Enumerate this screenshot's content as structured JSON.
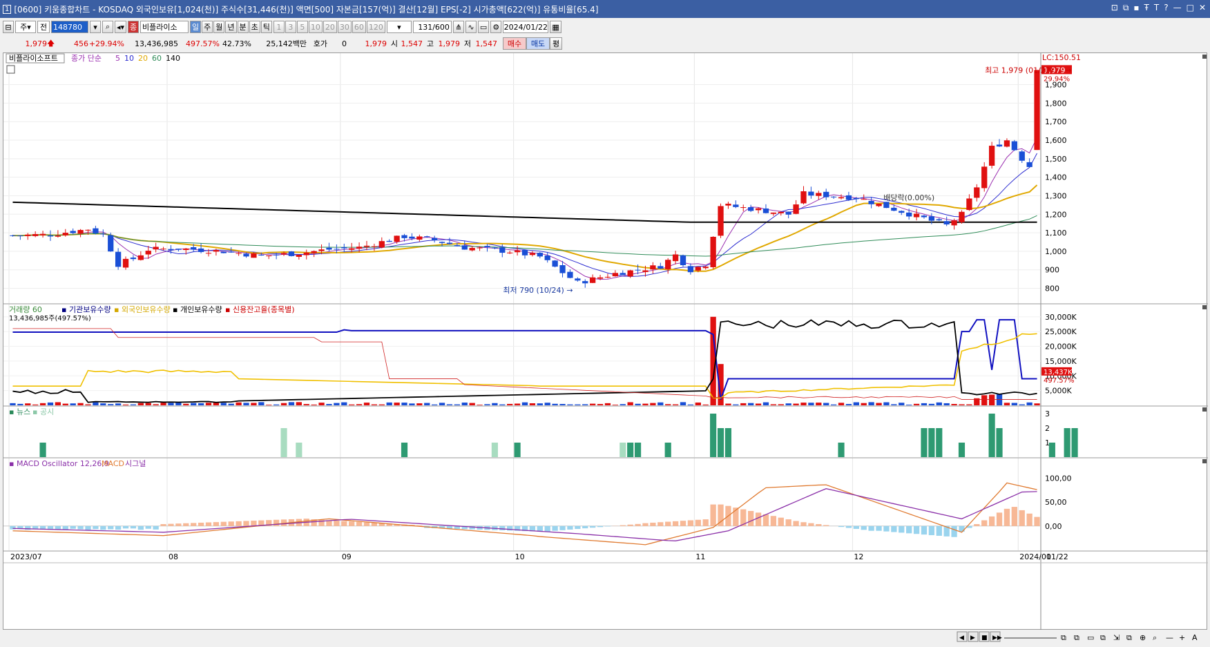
{
  "window": {
    "number": "1",
    "title": "[0600] 키움종합차트 - KOSDAQ 외국인보유[1,024(천)] 주식수[31,446(천)] 액면[500] 자본금[157(억)] 결산[12월] EPS[-2] 시가총액[622(억)] 유통비율[65.4]",
    "controls": [
      "⊡",
      "⧉",
      "▪",
      "Ŧ",
      "T",
      "?",
      "—",
      "□",
      "✕"
    ]
  },
  "toolbar": {
    "period_type": "주",
    "mode": "전",
    "code": "148780",
    "stock_name": "비플라이소",
    "periods": [
      "일",
      "주",
      "월",
      "년",
      "분",
      "초",
      "틱"
    ],
    "active_period": "일",
    "minutes": [
      "1",
      "3",
      "5",
      "10",
      "20",
      "30",
      "60",
      "120"
    ],
    "count": "131",
    "count_total": "/600",
    "date": "2024/01/22"
  },
  "quote": {
    "price": "1,979",
    "change": "456",
    "change_pct": "+29.94%",
    "volume": "13,436,985",
    "vol_ratio": "497.57%",
    "turnover": "42.73%",
    "amount": "25,142백만",
    "hoga_label": "호가",
    "hoga": "0",
    "p1": "1,979",
    "open_label": "시",
    "open": "1,547",
    "high_label": "고",
    "high": "1,979",
    "low_label": "저",
    "low": "1,547",
    "buy": "매수",
    "sell": "매도",
    "flat": "평"
  },
  "price_panel": {
    "stock_label": "비플라이소프트",
    "ma_label": "종가 단순",
    "ma": [
      "5",
      "10",
      "20",
      "60",
      "140"
    ],
    "ma_colors": [
      "#9b30b0",
      "#2b2bd0",
      "#e0a800",
      "#2e8b57",
      "#000000"
    ],
    "max_label": "최고 1,979 (01/22)",
    "min_label": "최저 790 (10/24)",
    "div_label": "배당락(0.00%)",
    "lc_label": "LC:150.51",
    "cur_label": "1,979",
    "pct_label": "29.94%",
    "y_ticks": [
      "1,900",
      "1,800",
      "1,700",
      "1,600",
      "1,500",
      "1,400",
      "1,300",
      "1,200",
      "1,100",
      "1,000",
      "900",
      "800"
    ]
  },
  "vol_panel": {
    "labels": [
      "거래량 60",
      "기관보유수량",
      "외국인보유수량",
      "개인보유수량",
      "신용잔고율(종목별)"
    ],
    "label_colors": [
      "#3a8a3a",
      "#000080",
      "#d4a800",
      "#000000",
      "#cc0000"
    ],
    "value_text": "13,436,985주(497.57%)",
    "y_ticks": [
      "30,000K",
      "25,000K",
      "20,000K",
      "15,000K",
      "10,000K",
      "5,000K"
    ],
    "cur_tag": "13,437K",
    "pct_tag": "497.57%"
  },
  "news_panel": {
    "labels": [
      "뉴스",
      "공시"
    ],
    "y_ticks": [
      "3",
      "2",
      "1"
    ]
  },
  "macd_panel": {
    "label": "MACD Oscillator 12,26,9",
    "label2": "MACD",
    "label3": "시그널",
    "y_ticks": [
      "100,00",
      "50,00",
      "0,00"
    ]
  },
  "x_axis": {
    "labels": [
      "2023/07",
      "08",
      "09",
      "10",
      "11",
      "12",
      "2024/01",
      "01/22"
    ]
  },
  "chart_data": {
    "type": "candlestick",
    "x": [
      "07-03",
      "07-04",
      "07-05",
      "07-06",
      "07-07",
      "07-10",
      "07-11",
      "07-12",
      "07-13",
      "07-14",
      "07-17",
      "07-18",
      "07-19",
      "07-20",
      "07-21",
      "07-24",
      "07-25",
      "07-26",
      "07-27",
      "07-28",
      "07-31",
      "08-01",
      "08-02",
      "08-03",
      "08-04",
      "08-07",
      "08-08",
      "08-09",
      "08-10",
      "08-11",
      "08-14",
      "08-16",
      "08-17",
      "08-18",
      "08-21",
      "08-22",
      "08-23",
      "08-24",
      "08-25",
      "08-28",
      "08-29",
      "08-30",
      "08-31",
      "09-01",
      "09-04",
      "09-05",
      "09-06",
      "09-07",
      "09-08",
      "09-11",
      "09-12",
      "09-13",
      "09-14",
      "09-15",
      "09-18",
      "09-19",
      "09-20",
      "09-21",
      "09-22",
      "09-25",
      "09-26",
      "09-27",
      "10-04",
      "10-05",
      "10-06",
      "10-10",
      "10-11",
      "10-12",
      "10-13",
      "10-16",
      "10-17",
      "10-18",
      "10-19",
      "10-20",
      "10-23",
      "10-24",
      "10-25",
      "10-26",
      "10-27",
      "10-30",
      "10-31",
      "11-01",
      "11-02",
      "11-03",
      "11-06",
      "11-07",
      "11-08",
      "11-09",
      "11-10",
      "11-13",
      "11-14",
      "11-15",
      "11-16",
      "11-17",
      "11-20",
      "11-21",
      "11-22",
      "11-23",
      "11-24",
      "11-27",
      "11-28",
      "11-29",
      "11-30",
      "12-01",
      "12-04",
      "12-05",
      "12-06",
      "12-07",
      "12-08",
      "12-11",
      "12-12",
      "12-13",
      "12-14",
      "12-15",
      "12-18",
      "12-19",
      "12-20",
      "12-21",
      "12-22",
      "12-26",
      "12-27",
      "12-28",
      "01-02",
      "01-03",
      "01-04",
      "01-05",
      "01-08",
      "01-09",
      "01-10",
      "01-11",
      "01-12",
      "01-15",
      "01-16",
      "01-17",
      "01-18",
      "01-19",
      "01-22"
    ],
    "series": []
  }
}
